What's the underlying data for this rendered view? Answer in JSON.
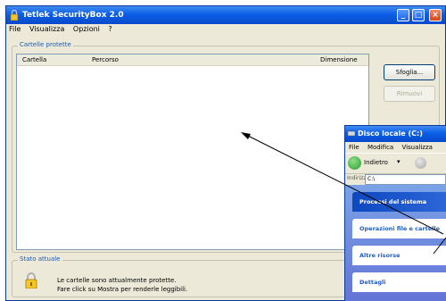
{
  "app": {
    "title": "Tetlek SecurityBox 2.0",
    "menu": [
      "File",
      "Visualizza",
      "Opzioni",
      "?"
    ]
  },
  "protected_folders": {
    "group_label": "Cartelle protette",
    "columns": [
      "Cartella",
      "Percorso",
      "Dimensione"
    ],
    "browse_button": "Sfoglia...",
    "remove_button": "Rimuovi"
  },
  "status": {
    "group_label": "Stato attuale",
    "line1": "Le cartelle sono attualmente protette.",
    "line2": "Fare click su Mostra per renderle leggibili."
  },
  "explorer": {
    "title": "Disco locale (C:)",
    "menu": [
      "File",
      "Modifica",
      "Visualizza"
    ],
    "back_label": "Indietro",
    "address_label": "Indirizzo",
    "address_value": "C:\\",
    "tasks": [
      "Processi del sistema",
      "Operazioni file e cartelle",
      "Altre risorse",
      "Dettagli"
    ]
  },
  "colors": {
    "titlebar": "#0c5ee6",
    "window_bg": "#ece9d8",
    "task_pane": "#6f8ee0"
  }
}
